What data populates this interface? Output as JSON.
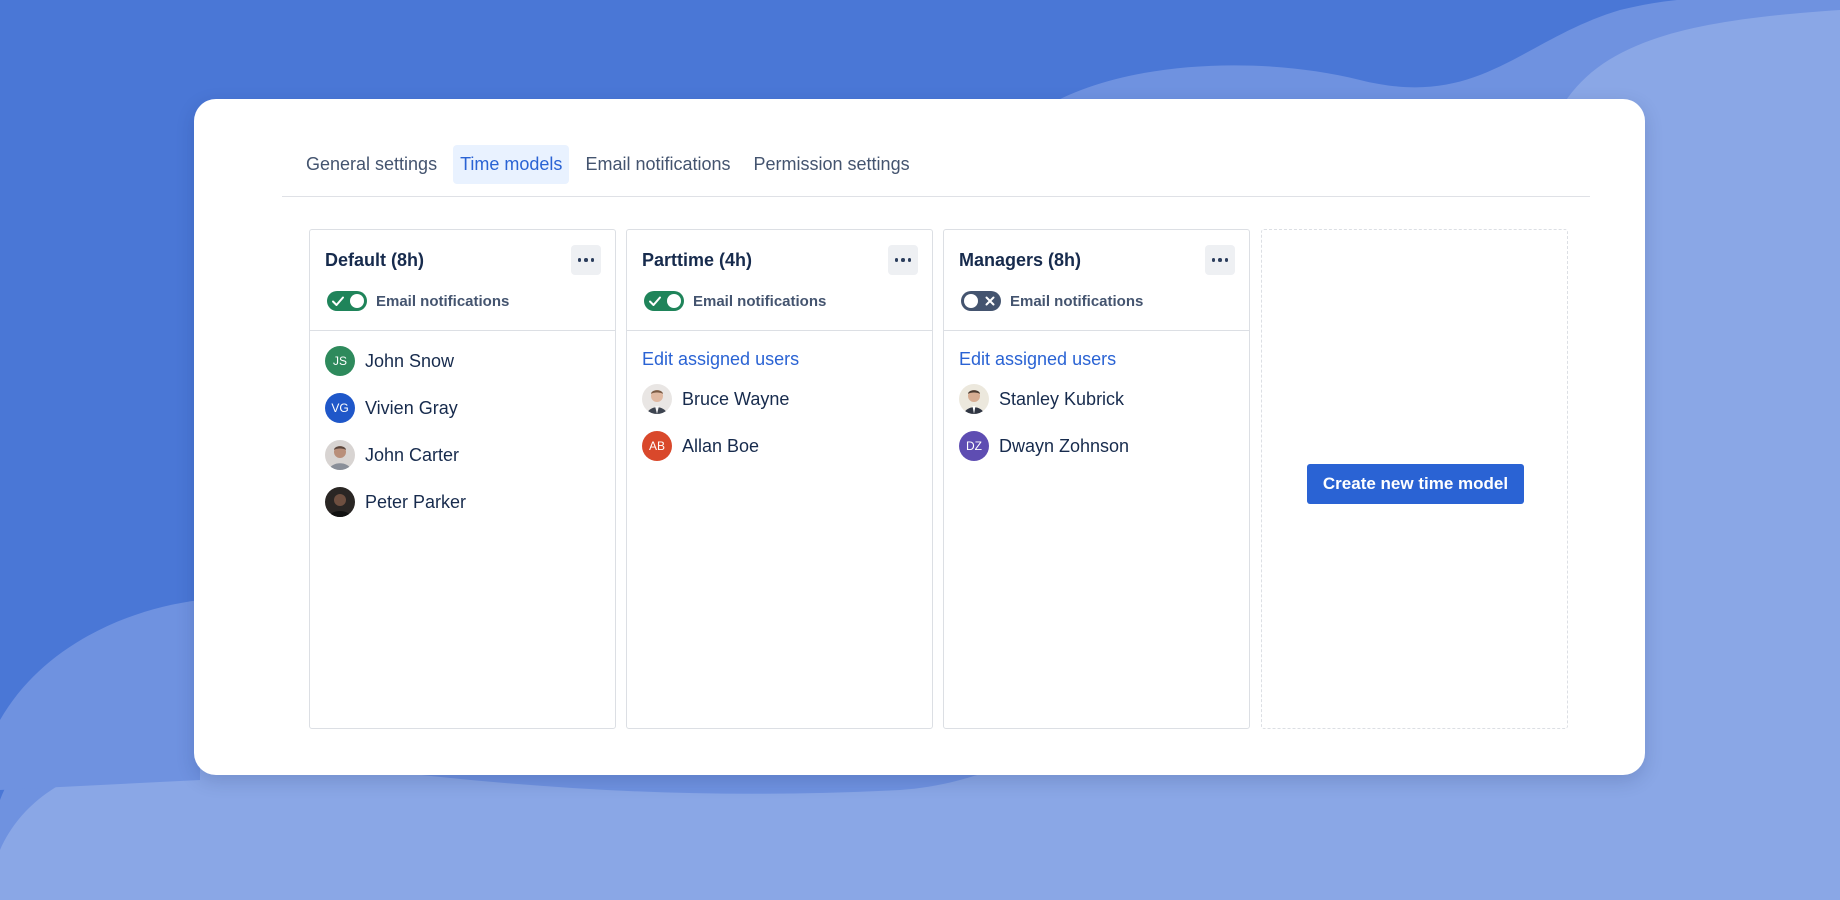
{
  "tabs": [
    {
      "label": "General settings",
      "active": false
    },
    {
      "label": "Time models",
      "active": true
    },
    {
      "label": "Email notifications",
      "active": false
    },
    {
      "label": "Permission settings",
      "active": false
    }
  ],
  "columns": [
    {
      "title": "Default (8h)",
      "email_notifications": {
        "label": "Email notifications",
        "enabled": true
      },
      "users": [
        {
          "name": "John Snow",
          "initials": "JS",
          "avatar_color": "#2e8a5c",
          "photo": false
        },
        {
          "name": "Vivien Gray",
          "initials": "VG",
          "avatar_color": "#1f57c9",
          "photo": false
        },
        {
          "name": "John Carter",
          "photo": true
        },
        {
          "name": "Peter Parker",
          "photo": true
        }
      ]
    },
    {
      "title": "Parttime (4h)",
      "email_notifications": {
        "label": "Email notifications",
        "enabled": true
      },
      "edit_link": "Edit assigned users",
      "users": [
        {
          "name": "Bruce Wayne",
          "photo": true
        },
        {
          "name": "Allan Boe",
          "initials": "AB",
          "avatar_color": "#d9482b",
          "photo": false
        }
      ]
    },
    {
      "title": "Managers (8h)",
      "email_notifications": {
        "label": "Email notifications",
        "enabled": false
      },
      "edit_link": "Edit assigned users",
      "users": [
        {
          "name": "Stanley Kubrick",
          "photo": true
        },
        {
          "name": "Dwayn Zohnson",
          "initials": "DZ",
          "avatar_color": "#5e4db2",
          "photo": false
        }
      ]
    }
  ],
  "create_button": "Create new time model",
  "colors": {
    "background": "#4a77d6",
    "background_light": "#8aa7e6",
    "accent": "#2a63d4",
    "toggle_on": "#1f845a",
    "toggle_off": "#44546f"
  }
}
